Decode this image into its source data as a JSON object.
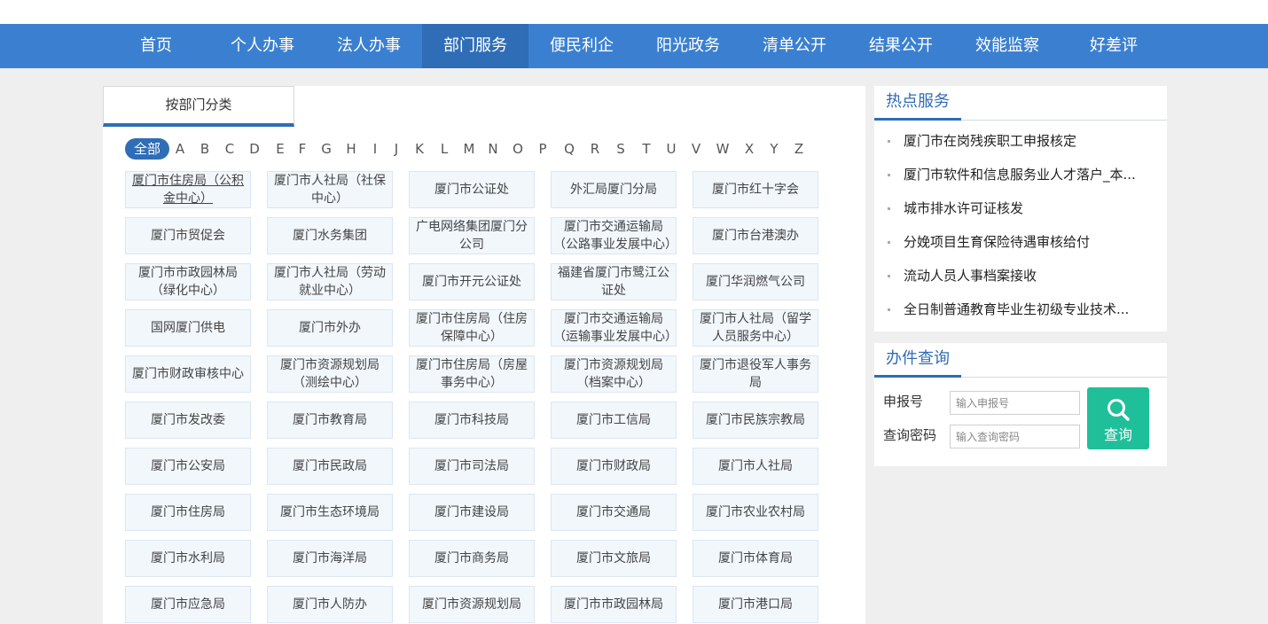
{
  "nav": {
    "items": [
      "首页",
      "个人办事",
      "法人办事",
      "部门服务",
      "便民利企",
      "阳光政务",
      "清单公开",
      "结果公开",
      "效能监察",
      "好差评"
    ],
    "active_index": 3
  },
  "tabs": {
    "dept_label": "按部门分类"
  },
  "alphabet": {
    "all_label": "全部",
    "letters": [
      "A",
      "B",
      "C",
      "D",
      "E",
      "F",
      "G",
      "H",
      "I",
      "J",
      "K",
      "L",
      "M",
      "N",
      "O",
      "P",
      "Q",
      "R",
      "S",
      "T",
      "U",
      "V",
      "W",
      "X",
      "Y",
      "Z"
    ]
  },
  "departments": [
    [
      "厦门市住房局（公积金中心）",
      "厦门市人社局（社保中心）",
      "厦门市公证处",
      "外汇局厦门分局",
      "厦门市红十字会"
    ],
    [
      "厦门市贸促会",
      "厦门水务集团",
      "广电网络集团厦门分公司",
      "厦门市交通运输局（公路事业发展中心）",
      "厦门市台港澳办"
    ],
    [
      "厦门市市政园林局（绿化中心）",
      "厦门市人社局（劳动就业中心）",
      "厦门市开元公证处",
      "福建省厦门市鹭江公证处",
      "厦门华润燃气公司"
    ],
    [
      "国网厦门供电",
      "厦门市外办",
      "厦门市住房局（住房保障中心）",
      "厦门市交通运输局（运输事业发展中心）",
      "厦门市人社局（留学人员服务中心）"
    ],
    [
      "厦门市财政审核中心",
      "厦门市资源规划局（测绘中心）",
      "厦门市住房局（房屋事务中心）",
      "厦门市资源规划局（档案中心）",
      "厦门市退役军人事务局"
    ],
    [
      "厦门市发改委",
      "厦门市教育局",
      "厦门市科技局",
      "厦门市工信局",
      "厦门市民族宗教局"
    ],
    [
      "厦门市公安局",
      "厦门市民政局",
      "厦门市司法局",
      "厦门市财政局",
      "厦门市人社局"
    ],
    [
      "厦门市住房局",
      "厦门市生态环境局",
      "厦门市建设局",
      "厦门市交通局",
      "厦门市农业农村局"
    ],
    [
      "厦门市水利局",
      "厦门市海洋局",
      "厦门市商务局",
      "厦门市文旅局",
      "厦门市体育局"
    ],
    [
      "厦门市应急局",
      "厦门市人防办",
      "厦门市资源规划局",
      "厦门市市政园林局",
      "厦门市港口局"
    ]
  ],
  "hot": {
    "title": "热点服务",
    "items": [
      "厦门市在岗残疾职工申报核定",
      "厦门市软件和信息服务业人才落户_本...",
      "城市排水许可证核发",
      "分娩项目生育保险待遇审核给付",
      "流动人员人事档案接收",
      "全日制普通教育毕业生初级专业技术..."
    ]
  },
  "query": {
    "title": "办件查询",
    "number_label": "申报号",
    "number_placeholder": "输入申报号",
    "password_label": "查询密码",
    "password_placeholder": "输入查询密码",
    "button_label": "查询",
    "button_icon": "search-icon"
  },
  "colors": {
    "nav_bg": "#3b80d0",
    "nav_active": "#2f6db6",
    "accent": "#2f6db6",
    "query_button": "#1fbf9a",
    "cell_bg": "#f2f7fc"
  }
}
